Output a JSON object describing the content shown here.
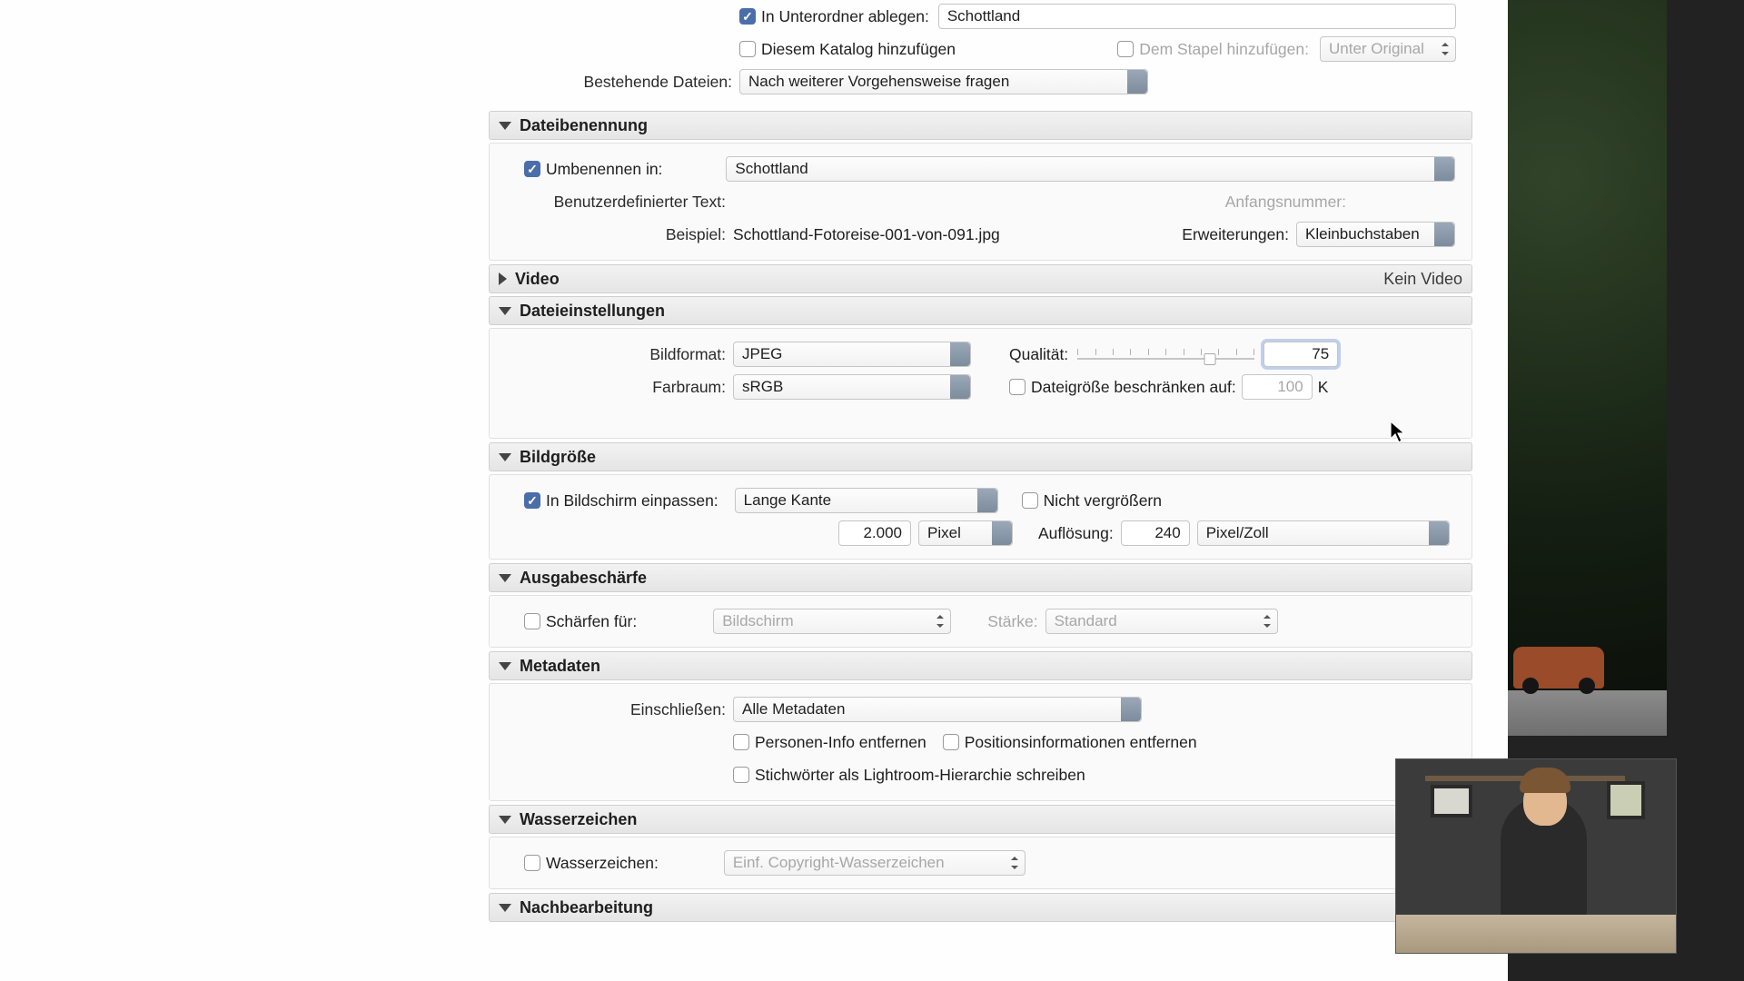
{
  "top": {
    "subfolder_label": "In Unterordner ablegen:",
    "subfolder_value": "Schottland",
    "add_catalog": "Diesem Katalog hinzufügen",
    "add_stack": "Dem Stapel hinzufügen:",
    "stack_position": "Unter Original",
    "existing_label": "Bestehende Dateien:",
    "existing_value": "Nach weiterer Vorgehensweise fragen"
  },
  "sections": {
    "naming": {
      "title": "Dateibenennung",
      "rename_to": "Umbenennen in:",
      "rename_value": "Schottland",
      "custom_text": "Benutzerdefinierter Text:",
      "start_num": "Anfangsnummer:",
      "example_label": "Beispiel:",
      "example_value": "Schottland-Fotoreise-001-von-091.jpg",
      "ext_label": "Erweiterungen:",
      "ext_value": "Kleinbuchstaben"
    },
    "video": {
      "title": "Video",
      "status": "Kein Video"
    },
    "file": {
      "title": "Dateieinstellungen",
      "format_label": "Bildformat:",
      "format_value": "JPEG",
      "quality_label": "Qualität:",
      "quality_value": "75",
      "colorspace_label": "Farbraum:",
      "colorspace_value": "sRGB",
      "limit_label": "Dateigröße beschränken auf:",
      "limit_value": "100",
      "limit_unit": "K"
    },
    "size": {
      "title": "Bildgröße",
      "fit_label": "In Bildschirm einpassen:",
      "fit_value": "Lange Kante",
      "no_enlarge": "Nicht vergrößern",
      "dim_value": "2.000",
      "dim_unit": "Pixel",
      "res_label": "Auflösung:",
      "res_value": "240",
      "res_unit": "Pixel/Zoll"
    },
    "sharpen": {
      "title": "Ausgabeschärfe",
      "for_label": "Schärfen für:",
      "for_value": "Bildschirm",
      "amount_label": "Stärke:",
      "amount_value": "Standard"
    },
    "metadata": {
      "title": "Metadaten",
      "include_label": "Einschließen:",
      "include_value": "Alle Metadaten",
      "remove_person": "Personen-Info entfernen",
      "remove_position": "Positionsinformationen entfernen",
      "keywords_hierarchy": "Stichwörter als Lightroom-Hierarchie schreiben"
    },
    "watermark": {
      "title": "Wasserzeichen",
      "label": "Wasserzeichen:",
      "value": "Einf. Copyright-Wasserzeichen"
    },
    "post": {
      "title": "Nachbearbeitung"
    }
  }
}
